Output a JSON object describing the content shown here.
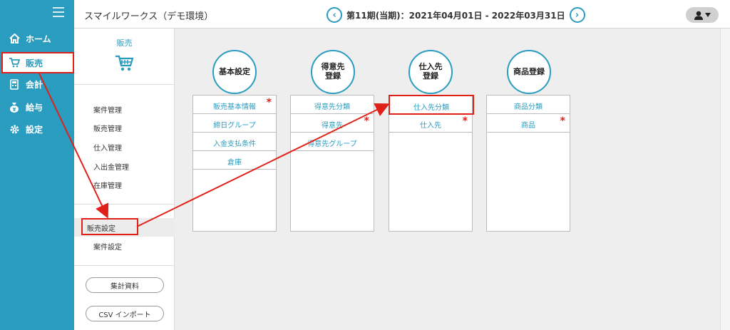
{
  "nav": {
    "items": [
      {
        "label": "ホーム",
        "icon": "home-icon"
      },
      {
        "label": "販売",
        "icon": "cart-icon"
      },
      {
        "label": "会計",
        "icon": "calculator-icon"
      },
      {
        "label": "給与",
        "icon": "money-bag-icon"
      },
      {
        "label": "設定",
        "icon": "gear-icon"
      }
    ]
  },
  "header": {
    "title": "スマイルワークス（デモ環境）",
    "period": "第11期(当期)：2021年04月01日 - 2022年03月31日",
    "prev_glyph": "‹",
    "next_glyph": "›"
  },
  "subpanel": {
    "heading": "販売",
    "items": [
      "案件管理",
      "販売管理",
      "仕入管理",
      "入出金管理",
      "在庫管理"
    ],
    "settings": [
      "販売設定",
      "案件設定"
    ],
    "buttons": [
      "集計資料",
      "CSV インポート"
    ]
  },
  "columns": [
    {
      "head": "基本設定",
      "items": [
        {
          "label": "販売基本情報",
          "required": true
        },
        {
          "label": "締日グループ",
          "required": false
        },
        {
          "label": "入金支払条件",
          "required": false
        },
        {
          "label": "倉庫",
          "required": false
        }
      ]
    },
    {
      "head": "得意先\n登録",
      "items": [
        {
          "label": "得意先分類",
          "required": false
        },
        {
          "label": "得意先",
          "required": true
        },
        {
          "label": "得意先グループ",
          "required": false
        }
      ]
    },
    {
      "head": "仕入先\n登録",
      "items": [
        {
          "label": "仕入先分類",
          "required": false
        },
        {
          "label": "仕入先",
          "required": true
        }
      ]
    },
    {
      "head": "商品登録",
      "items": [
        {
          "label": "商品分類",
          "required": false
        },
        {
          "label": "商品",
          "required": true
        }
      ]
    }
  ],
  "required_mark": "*",
  "colors": {
    "accent": "#2a9cbf",
    "highlight": "#e0211a"
  }
}
